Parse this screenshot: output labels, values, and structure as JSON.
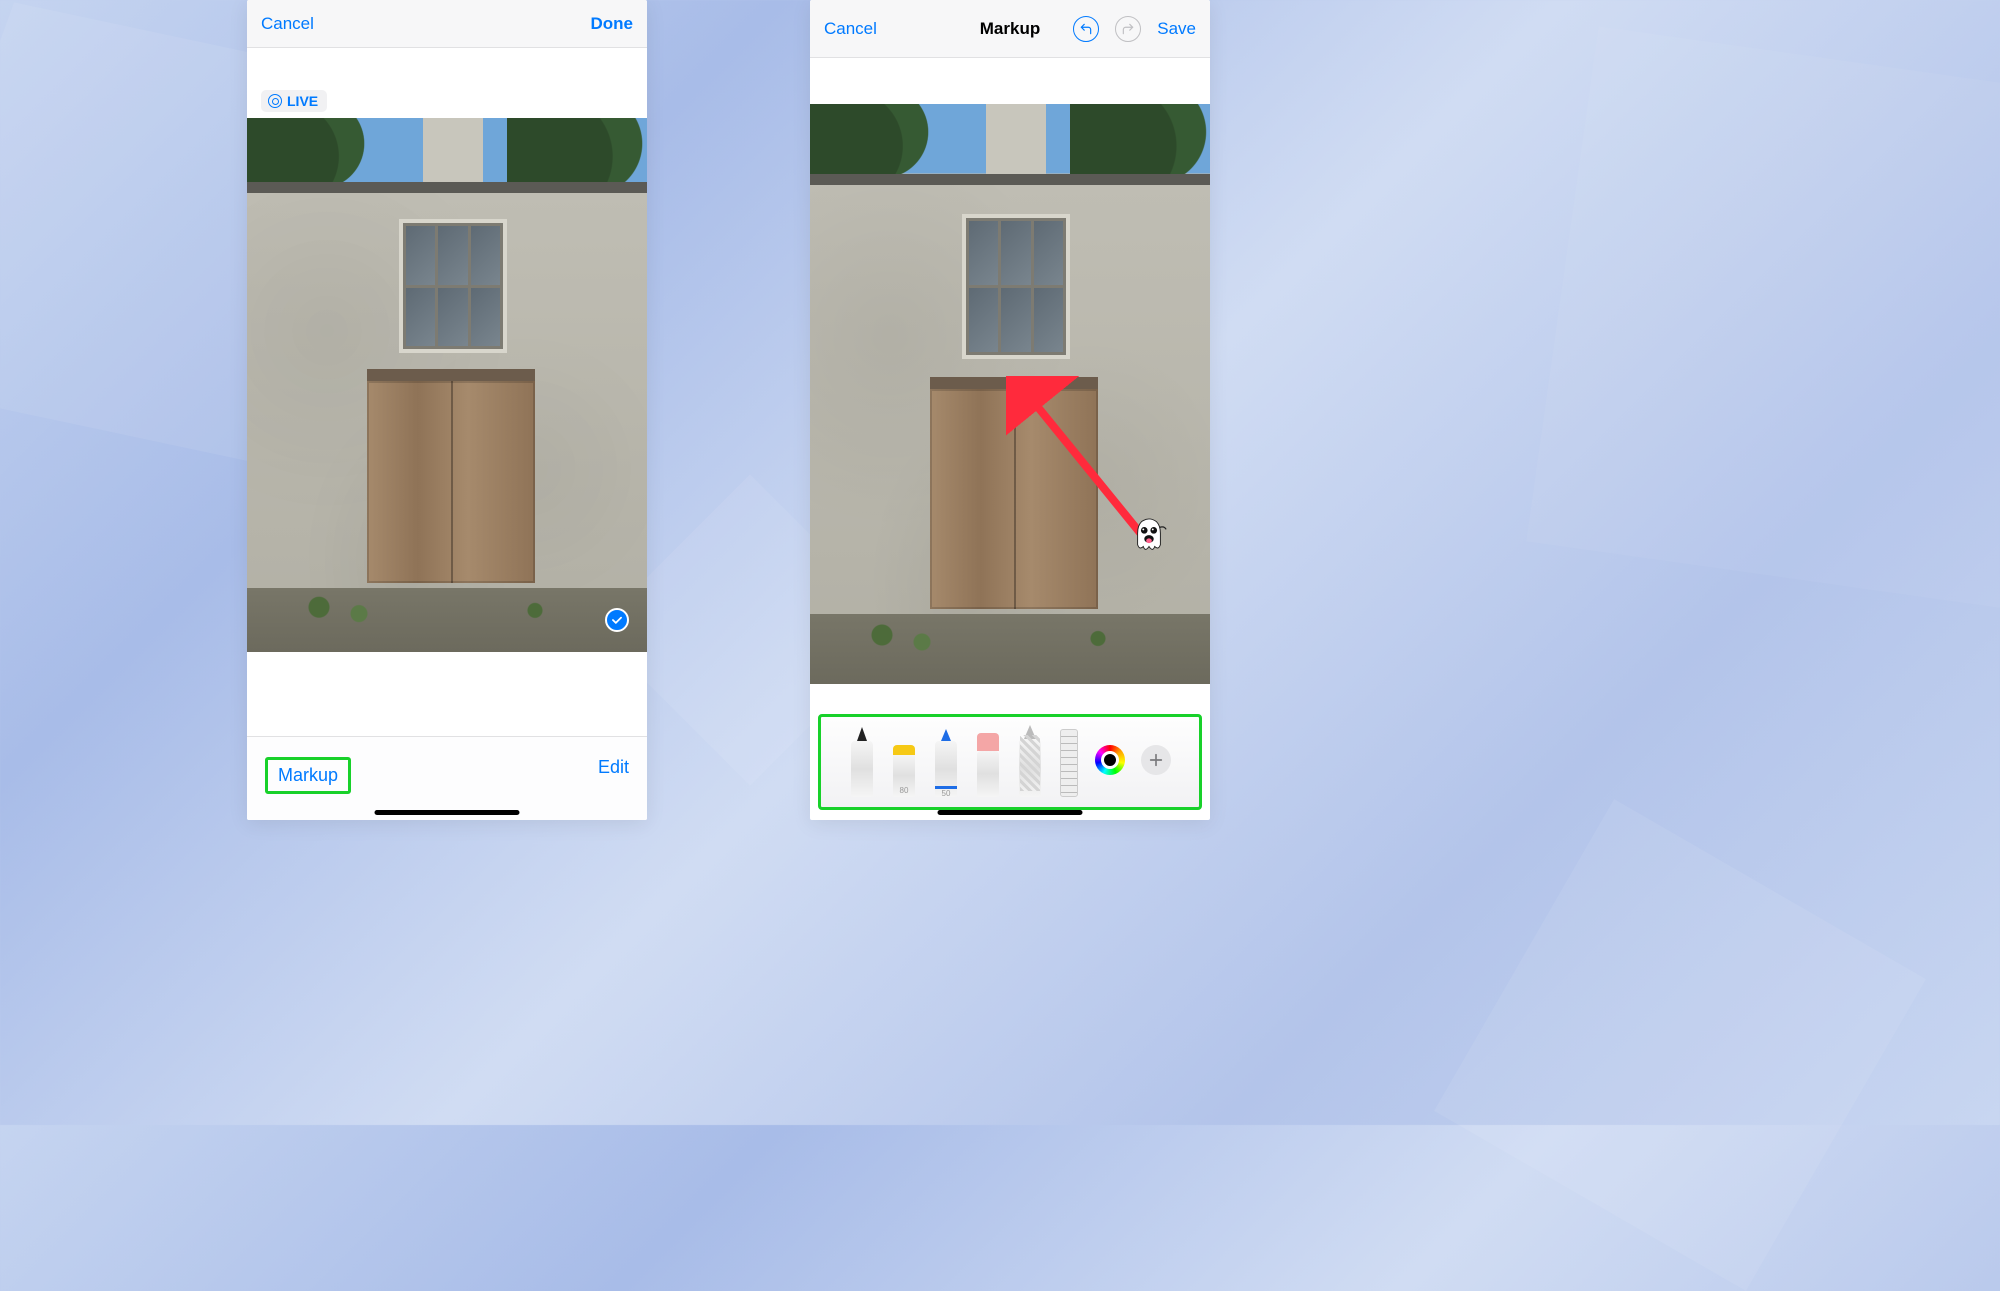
{
  "left_phone": {
    "nav": {
      "cancel": "Cancel",
      "done": "Done"
    },
    "live_label": "LIVE",
    "bottom": {
      "markup": "Markup",
      "edit": "Edit"
    }
  },
  "right_phone": {
    "nav": {
      "cancel": "Cancel",
      "title": "Markup",
      "save": "Save"
    },
    "tools": {
      "highlighter_label": "80",
      "pencil_label": "50",
      "color": "#000000"
    }
  }
}
